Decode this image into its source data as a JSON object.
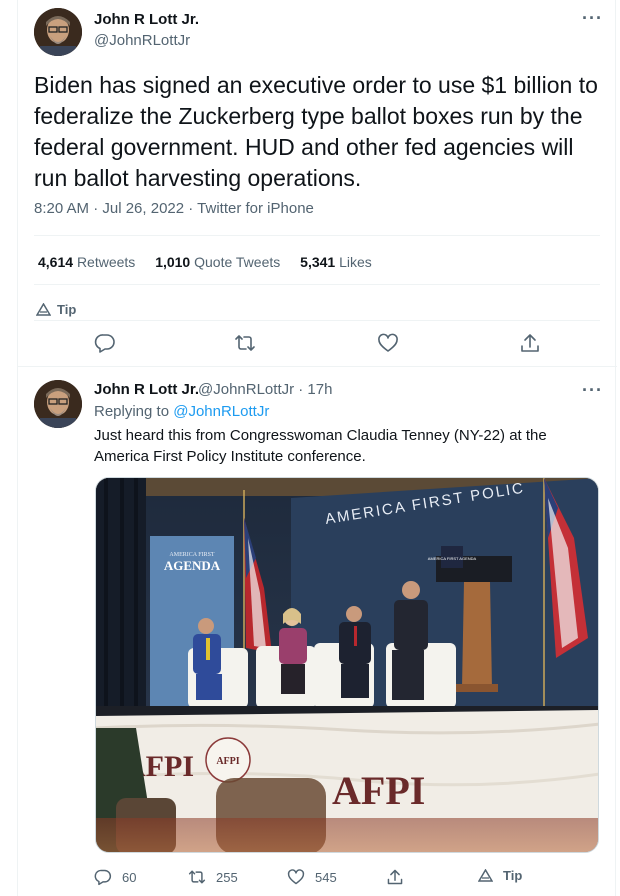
{
  "main_tweet": {
    "display_name": "John R Lott Jr.",
    "handle": "@JohnRLottJr",
    "more_label": "···",
    "text": "Biden has signed an executive order to use $1 billion to federalize the Zuckerberg type ballot boxes run by the federal government. HUD and other fed agencies will run ballot harvesting operations.",
    "timestamp": "8:20 AM · Jul 26, 2022 · Twitter for iPhone",
    "stats": [
      {
        "count": "4,614",
        "label": "Retweets"
      },
      {
        "count": "1,010",
        "label": "Quote Tweets"
      },
      {
        "count": "5,341",
        "label": "Likes"
      }
    ],
    "tip_label": "Tip",
    "actions": [
      "reply-icon",
      "retweet-icon",
      "like-icon",
      "share-icon"
    ]
  },
  "reply_tweet": {
    "display_name": "John R Lott Jr.",
    "handle_time": "@JohnRLottJr · 17h",
    "more_label": "···",
    "replying_prefix": "Replying to",
    "replying_to": "@JohnRLottJr",
    "text": "Just heard this from Congresswoman Claudia Tenney (NY-22) at the America First Policy Institute conference.",
    "photo": {
      "banner_text": "AMERICA FIRST POLIC",
      "poster_top": "AMERICA FIRST",
      "poster_main": "AGENDA",
      "podium_text": "AMERICA FIRST AGENDA",
      "stage_logo": "AFPI",
      "stage_left_text": "AFPI",
      "seal_text": "AFPI"
    },
    "actions": {
      "reply_count": "60",
      "retweet_count": "255",
      "like_count": "545",
      "tip_label": "Tip"
    }
  },
  "colors": {
    "text": "#0f1419",
    "secondary": "#536471",
    "link": "#1d9bf0",
    "border": "#eff3f4"
  }
}
